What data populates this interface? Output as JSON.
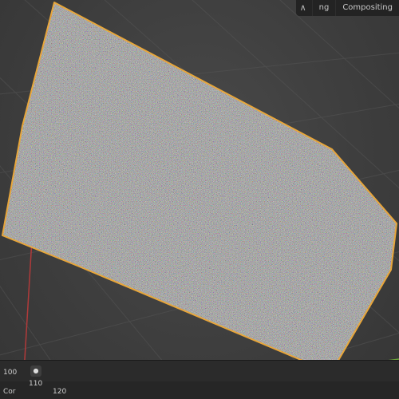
{
  "header": {
    "tabs": [
      {
        "label": "ng"
      },
      {
        "label": "Compositing"
      }
    ],
    "icon": "graph-icon"
  },
  "timeline": {
    "frame_labels": [
      "100",
      "110",
      "120"
    ],
    "left_label": "Cor"
  },
  "colors": {
    "selection_outline": "#e8a63a",
    "red_axis": "#b03a3a",
    "green_axis": "#6aa13a"
  }
}
